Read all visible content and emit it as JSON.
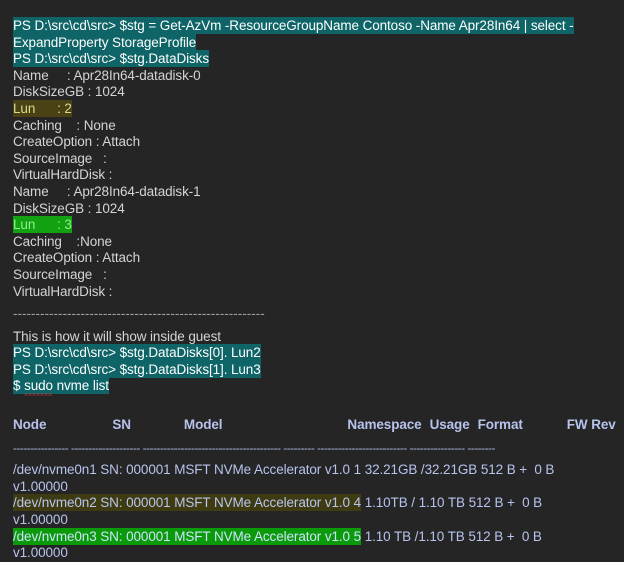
{
  "terminal": {
    "background_color": "#252526",
    "default_text_color": "#d4d4d4",
    "highlight_teal": "#0e6466",
    "highlight_olive": "#4a4214",
    "highlight_green": "#11a111",
    "nvme_text_color": "#b7c3ec",
    "spellcheck_underline_color": "#e03a3a"
  },
  "powershell": {
    "prompt": "PS D:\\src\\cd\\src> ",
    "command_1_part_1": "PS D:\\src\\cd\\src> $stg = Get-AzVm -ResourceGroupName Contoso -Name Apr28In64 | select -",
    "command_1_part_2": "ExpandProperty StorageProfile",
    "command_2": "PS D:\\src\\cd\\src> $stg.DataDisks"
  },
  "datadisks": [
    {
      "name_label": "Name",
      "name_sep": "     : ",
      "name_value": "Apr28In64-datadisk-0",
      "size_label": "DiskSizeGB",
      "size_sep": " : ",
      "size_value": "1024",
      "lun_text": "Lun      : 2",
      "lun_highlight": "olive",
      "caching_text": "Caching    : None",
      "createoption_text": "CreateOption : Attach",
      "sourceimage_text": "SourceImage   :",
      "vhd_text": "VirtualHardDisk :"
    },
    {
      "name_label": "Name",
      "name_sep": "     : ",
      "name_value": "Apr28In64-datadisk-1",
      "size_label": "DiskSizeGB",
      "size_sep": " : ",
      "size_value": "1024",
      "lun_text": "Lun      : 3",
      "lun_highlight": "green",
      "caching_text": "Caching    :None",
      "createoption_text": "CreateOption : Attach",
      "sourceimage_text": "SourceImage   :",
      "vhd_text": "VirtualHardDisk :"
    }
  ],
  "separator_dashes": "--------------------------------------------------------",
  "guest": {
    "note": "This is how it will show inside guest",
    "line_1": "PS D:\\src\\cd\\src> $stg.DataDisks[0]. Lun2",
    "line_2": "PS D:\\src\\cd\\src> $stg.DataDisks[1]. Lun3",
    "shell_prompt": "$ ",
    "shell_cmd_misspelled": "sudo",
    "shell_cmd_rest": " nvme list"
  },
  "nvme_table": {
    "headers": {
      "node": "Node",
      "sn": "SN",
      "model": "Model",
      "namespace": "Namespace",
      "usage": "Usage",
      "format": "Format",
      "fw_rev": "FW Rev"
    },
    "header_rule": "---------------- -------------------- ---------------------------------------- --------- -------------------------- ---------------- --------",
    "rows": [
      {
        "node": "/dev/nvme0n1",
        "sn": "SN: 000001",
        "model": "MSFT NVMe Accelerator v1.0",
        "namespace": "1",
        "usage": "32.21GB /32.21GB",
        "format": "512",
        "fw_rev": "B +  0 B",
        "fw_rev_continued": "v1.00000",
        "highlight": "none"
      },
      {
        "node": "/dev/nvme0n2",
        "sn": "SN: 000001",
        "model": "MSFT NVMe Accelerator v1.0",
        "namespace": "4",
        "usage": "1.10TB / 1.10 TB",
        "format": "512",
        "fw_rev": "B +  0 B",
        "fw_rev_continued": "v1.00000",
        "highlight": "olive"
      },
      {
        "node": "/dev/nvme0n3",
        "sn": "SN: 000001",
        "model": "MSFT NVMe Accelerator v1.0",
        "namespace": "5",
        "usage": "1.10 TB /1.10 TB",
        "format": "512",
        "fw_rev": "B +  0 B",
        "fw_rev_continued": "v1.00000",
        "highlight": "green"
      }
    ]
  }
}
